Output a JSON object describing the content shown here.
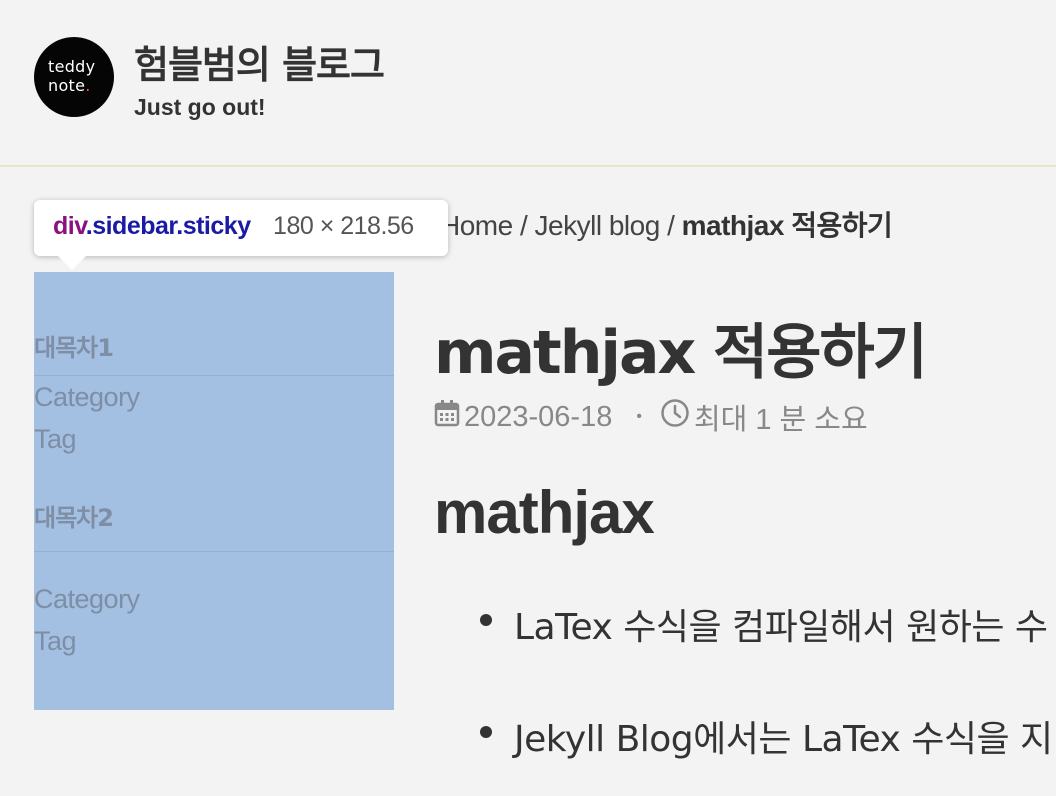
{
  "header": {
    "logo_line1": "teddy",
    "logo_line2": "note",
    "logo_dot": ".",
    "site_title": "험블범의 블로그",
    "subtitle": "Just go out!"
  },
  "breadcrumb": {
    "items": [
      "Home",
      "Jekyll blog"
    ],
    "separator": "/",
    "current": "mathjax 적용하기"
  },
  "devtools_tooltip": {
    "tag": "div",
    "classes": ".sidebar.sticky",
    "size": "180 × 218.56"
  },
  "sidebar": {
    "groups": [
      {
        "title": "대목차1",
        "links": [
          "Category",
          "Tag"
        ]
      },
      {
        "title": "대목차2",
        "links": [
          "Category",
          "Tag"
        ]
      }
    ]
  },
  "post": {
    "title": "mathjax 적용하기",
    "date": "2023-06-18",
    "read_time": "최대 1 분 소요",
    "separator": "•",
    "section_heading": "mathjax",
    "bullets": [
      "LaTex 수식을 컴파일해서 원하는 수",
      "Jekyll Blog에서는 LaTex 수식을 지"
    ]
  },
  "icons": [
    "calendar-icon",
    "clock-icon"
  ],
  "colors": {
    "background": "#f3f3f3",
    "sidebar_highlight": "#a3bfe1",
    "tooltip_tag": "#881280",
    "tooltip_class": "#1a1aa6"
  }
}
